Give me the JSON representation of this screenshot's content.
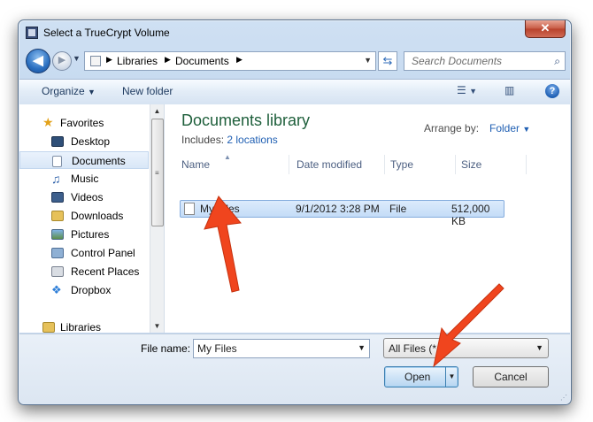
{
  "window": {
    "title": "Select a TrueCrypt Volume",
    "close_glyph": "✕"
  },
  "nav": {
    "back_glyph": "◀",
    "forward_glyph": "▶",
    "breadcrumbs": [
      "Libraries",
      "Documents"
    ],
    "search_placeholder": "Search Documents"
  },
  "toolbar": {
    "organize": "Organize",
    "new_folder": "New folder",
    "help": "?"
  },
  "sidebar": {
    "items": [
      {
        "label": "Favorites",
        "icon": "star-icon"
      },
      {
        "label": "Desktop",
        "icon": "desktop-icon"
      },
      {
        "label": "Documents",
        "icon": "documents-icon",
        "selected": true
      },
      {
        "label": "Music",
        "icon": "music-icon"
      },
      {
        "label": "Videos",
        "icon": "videos-icon"
      },
      {
        "label": "Downloads",
        "icon": "downloads-icon"
      },
      {
        "label": "Pictures",
        "icon": "pictures-icon"
      },
      {
        "label": "Control Panel",
        "icon": "control-panel-icon"
      },
      {
        "label": "Recent Places",
        "icon": "recent-places-icon"
      },
      {
        "label": "Dropbox",
        "icon": "dropbox-icon"
      },
      {
        "label": "Libraries",
        "icon": "libraries-icon"
      }
    ]
  },
  "library": {
    "title": "Documents library",
    "includes_label": "Includes:",
    "includes_link": "2 locations",
    "arrange_label": "Arrange by:",
    "arrange_value": "Folder"
  },
  "columns": [
    "Name",
    "Date modified",
    "Type",
    "Size"
  ],
  "files": [
    {
      "name": "My Files",
      "date": "9/1/2012 3:28 PM",
      "type": "File",
      "size": "512,000 KB"
    }
  ],
  "footer": {
    "file_name_label": "File name:",
    "file_name_value": "My Files",
    "filter_value": "All Files (*.*)",
    "open_label": "Open",
    "cancel_label": "Cancel"
  },
  "colors": {
    "arrow": "#f0451e",
    "library_title": "#1e5f3b",
    "link": "#1f5fb3"
  }
}
